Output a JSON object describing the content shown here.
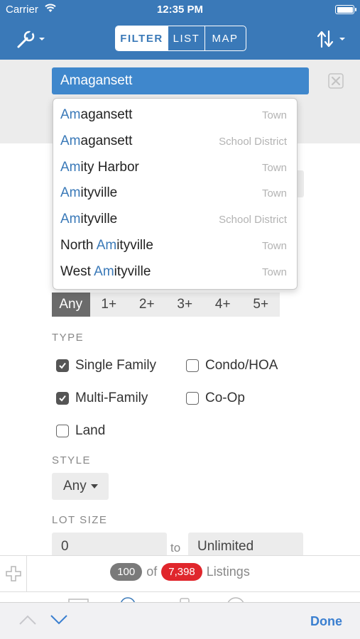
{
  "status": {
    "carrier": "Carrier",
    "time": "12:35 PM"
  },
  "nav": {
    "tabs": [
      {
        "label": "FILTER",
        "active": true
      },
      {
        "label": "LIST",
        "active": false
      },
      {
        "label": "MAP",
        "active": false
      }
    ],
    "left_icon": "wrench-icon",
    "right_icon": "sort-icon"
  },
  "search": {
    "value": "Amagansett",
    "clear_icon": "clear-icon"
  },
  "suggestions": [
    {
      "match": "Am",
      "rest": "agansett",
      "prefix": "",
      "kind": "Town"
    },
    {
      "match": "Am",
      "rest": "agansett",
      "prefix": "",
      "kind": "School District"
    },
    {
      "match": "Am",
      "rest": "ity Harbor",
      "prefix": "",
      "kind": "Town"
    },
    {
      "match": "Am",
      "rest": "ityville",
      "prefix": "",
      "kind": "Town"
    },
    {
      "match": "Am",
      "rest": "ityville",
      "prefix": "",
      "kind": "School District"
    },
    {
      "match": "Am",
      "rest": "ityville",
      "prefix": "North ",
      "kind": "Town"
    },
    {
      "match": "Am",
      "rest": "ityville",
      "prefix": "West ",
      "kind": "Town"
    }
  ],
  "beds": {
    "options": [
      "Any",
      "1+",
      "2+",
      "3+",
      "4+",
      "5+"
    ],
    "selected": "Any"
  },
  "type": {
    "label": "TYPE",
    "options": [
      {
        "label": "Single Family",
        "checked": true
      },
      {
        "label": "Condo/HOA",
        "checked": false
      },
      {
        "label": "Multi-Family",
        "checked": true
      },
      {
        "label": "Co-Op",
        "checked": false
      },
      {
        "label": "Land",
        "checked": false
      }
    ]
  },
  "style": {
    "label": "STYLE",
    "value": "Any"
  },
  "lot_size": {
    "label": "LOT SIZE",
    "min": "0",
    "to": "to",
    "max": "Unlimited"
  },
  "count": {
    "shown": "100",
    "of": "of",
    "total": "7,398",
    "suffix": "Listings"
  },
  "keyboard_bar": {
    "done": "Done"
  },
  "colors": {
    "primary": "#3a79b8",
    "input": "#3f87cc",
    "badge_red": "#e0262c"
  }
}
